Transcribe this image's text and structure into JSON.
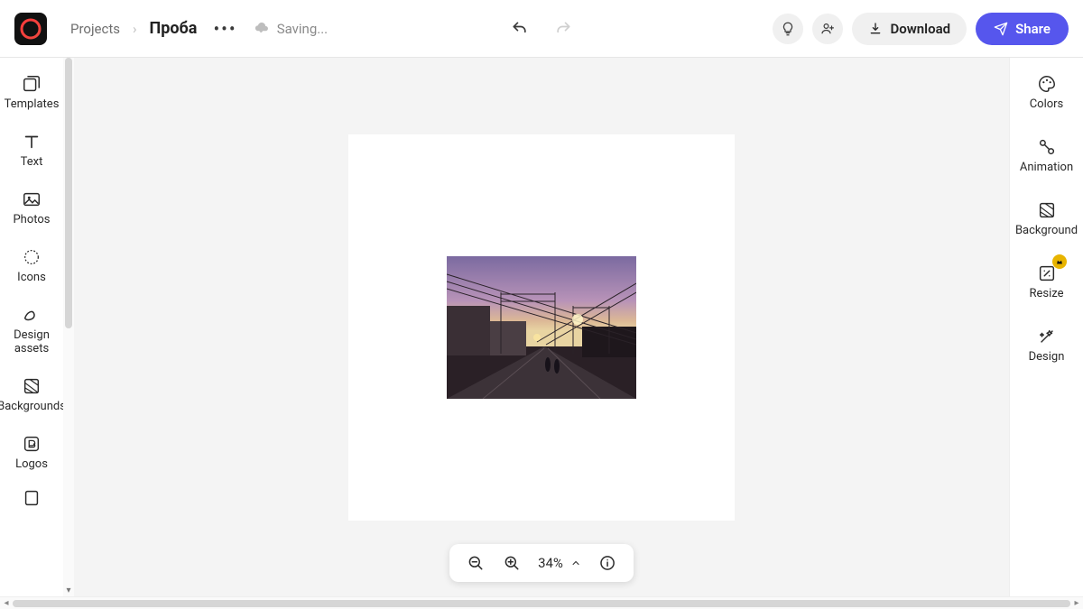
{
  "header": {
    "breadcrumb_root": "Projects",
    "project_title": "Проба",
    "saving_label": "Saving...",
    "download_label": "Download",
    "share_label": "Share"
  },
  "left_rail": {
    "templates": "Templates",
    "text": "Text",
    "photos": "Photos",
    "icons": "Icons",
    "design_assets": "Design assets",
    "backgrounds": "Backgrounds",
    "logos": "Logos"
  },
  "right_rail": {
    "colors": "Colors",
    "animation": "Animation",
    "background": "Background",
    "resize": "Resize",
    "design": "Design"
  },
  "zoom": {
    "percent": "34%"
  },
  "colors": {
    "accent": "#5656ed",
    "sky_top": "#8e7aa8",
    "sky_mid": "#c9a2c0",
    "horizon": "#e8cc9a",
    "ground": "#2b2126"
  }
}
